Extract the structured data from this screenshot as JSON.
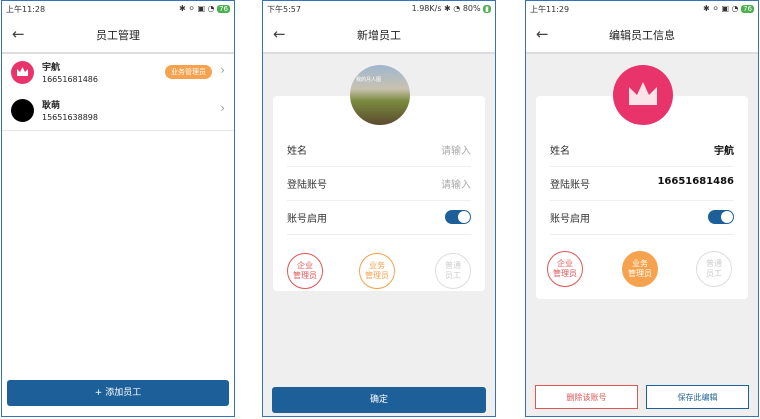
{
  "screen1": {
    "status_time": "上午11:28",
    "status_right": "✱ ⚪ ▣ ◔",
    "battery": "76",
    "title": "员工管理",
    "employees": [
      {
        "name": "宇航",
        "phone": "16651681486",
        "badge": "业务管理员"
      },
      {
        "name": "耿萌",
        "phone": "15651638898",
        "badge": ""
      }
    ],
    "add_button": "+ 添加员工"
  },
  "screen2": {
    "status_time": "下午5:57",
    "status_right": "1.98K/s ✱ ◔ 80%",
    "battery": "",
    "title": "新增员工",
    "photo_caption": "我的月人图",
    "fields": [
      {
        "label": "姓名",
        "value": "请输入"
      },
      {
        "label": "登陆账号",
        "value": "请输入"
      },
      {
        "label": "账号启用",
        "value": ""
      }
    ],
    "roles": [
      "企业\n管理员",
      "业务\n管理员",
      "普通\n员工"
    ],
    "confirm_button": "确定"
  },
  "screen3": {
    "status_time": "上午11:29",
    "status_right": "✱ ⚪ ▣ ◔",
    "battery": "76",
    "title": "编辑员工信息",
    "fields": [
      {
        "label": "姓名",
        "value": "宇航"
      },
      {
        "label": "登陆账号",
        "value": "16651681486"
      },
      {
        "label": "账号启用",
        "value": ""
      }
    ],
    "roles": [
      "企业\n管理员",
      "业务\n管理员",
      "普通\n员工"
    ],
    "delete_button": "删除该账号",
    "save_button": "保存此编辑"
  },
  "colors": {
    "primary": "#1d5f98",
    "orange": "#f7a24e",
    "red": "#e25555",
    "pink": "#e8336b"
  }
}
